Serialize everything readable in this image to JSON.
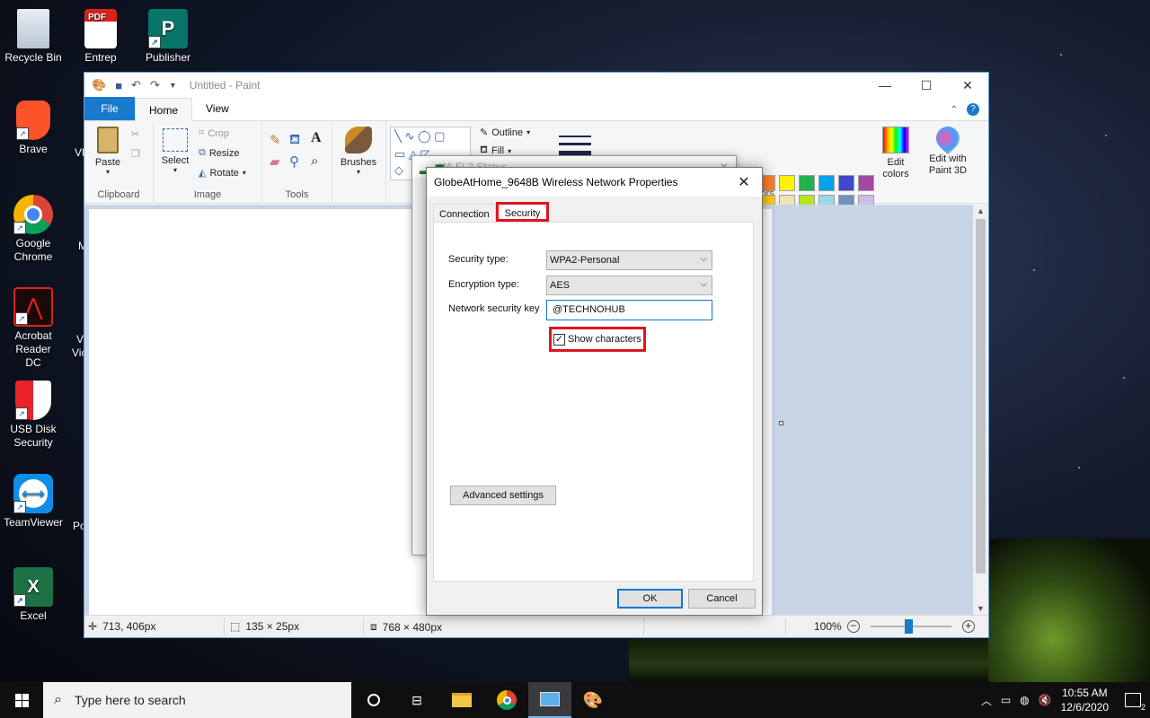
{
  "desktop": {
    "icons": [
      {
        "label": "Recycle Bin"
      },
      {
        "label": "Entrep"
      },
      {
        "label": "Publisher"
      },
      {
        "label": "Brave"
      },
      {
        "label": "Google Chrome"
      },
      {
        "label": "Acrobat Reader DC"
      },
      {
        "label": "USB Disk Security"
      },
      {
        "label": "TeamViewer"
      },
      {
        "label": "Excel"
      }
    ],
    "partial_labels": [
      "VL",
      "M",
      "Vi",
      "Vic",
      "Po"
    ]
  },
  "paint": {
    "title": "Untitled - Paint",
    "tabs": [
      "File",
      "Home",
      "View"
    ],
    "active_tab": "Home",
    "groups": {
      "clipboard": {
        "label": "Clipboard",
        "paste": "Paste"
      },
      "image": {
        "label": "Image",
        "select": "Select",
        "crop": "Crop",
        "resize": "Resize",
        "rotate": "Rotate"
      },
      "tools": {
        "label": "Tools"
      },
      "brushes": {
        "label": "Brushes"
      },
      "shapes": {
        "outline": "Outline",
        "fill": "Fill"
      },
      "colors": {
        "label": "ors",
        "edit_colors": "Edit colors",
        "edit_paint3d": "Edit with Paint 3D"
      }
    },
    "palette": [
      "#000000",
      "#7f7f7f",
      "#880015",
      "#ed1c24",
      "#ff7f27",
      "#fff200",
      "#22b14c",
      "#00a2e8",
      "#3f48cc",
      "#a349a4",
      "#ffffff",
      "#c3c3c3",
      "#b97a57",
      "#ffaec9",
      "#ffc90e",
      "#efe4b0",
      "#b5e61d",
      "#99d9ea",
      "#7092be",
      "#c8bfe7"
    ],
    "status": {
      "cursor_pos": "713, 406px",
      "selection_size": "135 × 25px",
      "image_size": "768 × 480px",
      "zoom": "100%"
    }
  },
  "wifi_status": {
    "title": "Wi-Fi 2 Status"
  },
  "dialog": {
    "title": "GlobeAtHome_9648B Wireless Network Properties",
    "tabs": [
      "Connection",
      "Security"
    ],
    "selected_tab": "Security",
    "security_type_label": "Security type:",
    "security_type_value": "WPA2-Personal",
    "encryption_type_label": "Encryption type:",
    "encryption_type_value": "AES",
    "key_label": "Network security key",
    "key_value": "@TECHNOHUB",
    "show_characters_label": "Show characters",
    "show_characters_checked": true,
    "advanced_button": "Advanced settings",
    "ok_button": "OK",
    "cancel_button": "Cancel"
  },
  "taskbar": {
    "search_placeholder": "Type here to search",
    "time": "10:55 AM",
    "date": "12/6/2020",
    "notification_count": "2"
  }
}
